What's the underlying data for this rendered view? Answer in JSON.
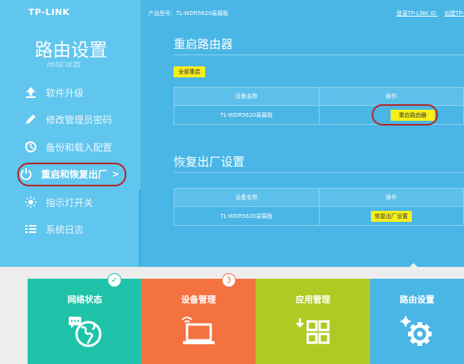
{
  "brand": {
    "logo": "TP-LINK"
  },
  "header": {
    "model_label": "产品型号：TL-WDR5620易展版",
    "login_link": "登录TP-LINK ID",
    "extra_link": "创建TP-"
  },
  "sidebar": {
    "title": "路由设置",
    "partial_item": "高级设置",
    "items": [
      {
        "label": "软件升级",
        "icon": "upload-icon"
      },
      {
        "label": "修改管理员密码",
        "icon": "pencil-icon"
      },
      {
        "label": "备份和载入配置",
        "icon": "backup-icon"
      },
      {
        "label": "重启和恢复出厂",
        "icon": "power-icon",
        "active": true,
        "chevron": ">"
      },
      {
        "label": "指示灯开关",
        "icon": "led-icon"
      },
      {
        "label": "系统日志",
        "icon": "log-icon"
      }
    ]
  },
  "restart": {
    "title": "重启路由器",
    "restart_all": "全部重启",
    "columns": [
      "设备名称",
      "操作"
    ],
    "rows": [
      {
        "device": "TL-WDR5620易展版",
        "action": "重启路由器"
      }
    ]
  },
  "factory": {
    "title": "恢复出厂设置",
    "columns": [
      "设备名称",
      "操作"
    ],
    "rows": [
      {
        "device": "TL-WDR5620易展版",
        "action": "恢复出厂设置"
      }
    ]
  },
  "tiles": [
    {
      "label": "网络状态",
      "color": "#1fc3a9",
      "badge": "✓",
      "badge_color": "#1fc3a9"
    },
    {
      "label": "设备管理",
      "color": "#f47140",
      "badge": "3",
      "badge_color": "#f47140"
    },
    {
      "label": "应用管理",
      "color": "#b1c923"
    },
    {
      "label": "路由设置",
      "color": "#49b6e6"
    }
  ],
  "colors": {
    "sidebar_bg": "#60c6ee",
    "main_bg": "#49b6e6",
    "highlight_oval": "#b3262a",
    "button_yellow": "#f7ee1a"
  }
}
